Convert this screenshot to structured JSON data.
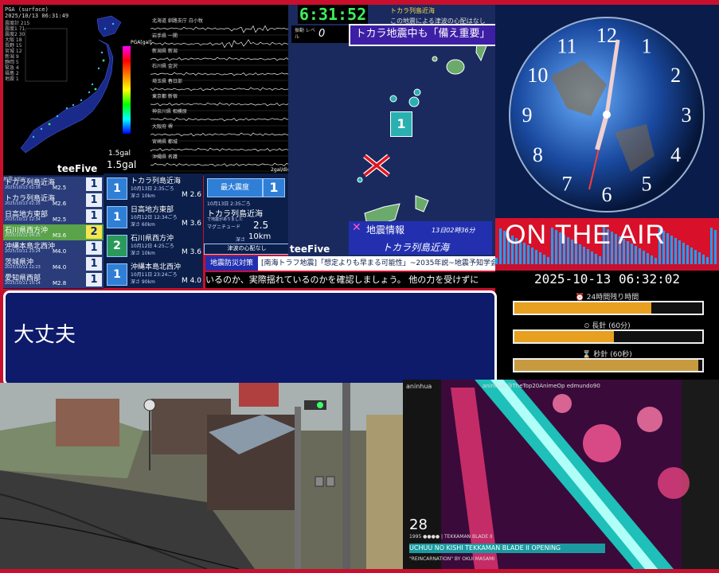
{
  "seismo": {
    "header_line1": "PGA (surface)",
    "header_line2": "2025/10/13 06:31:49",
    "scale_label": "PGA[gal]",
    "gal_value": "1.5gal",
    "small_gal": "1.5gal",
    "unit_label": "2gal/div",
    "stations": [
      "北海道 釧路支庁 白小牧",
      "岩手県 一関",
      "新潟県 新潟",
      "石川県 金沢",
      "埼玉県 春日部",
      "東京都 新宿",
      "神奈川県 相模原",
      "大阪府 堺",
      "宮崎県 都城",
      "沖縄県 名護"
    ],
    "stats": [
      "震度計 215",
      "震度1 71",
      "震度2 30",
      "大阪 18",
      "長野 15",
      "宮城 12",
      "新潟 9",
      "静岡 5",
      "緊急 4",
      "福島 2",
      "地震 1"
    ]
  },
  "logo1": "teeFive",
  "list": {
    "header": "地震 NEW",
    "rows": [
      {
        "name": "トカラ列島近海",
        "date": "2025/10/13 02:36",
        "mag": "M2.5",
        "int": "1",
        "hl": false
      },
      {
        "name": "トカラ列島近海",
        "date": "2025/10/13 02:35",
        "mag": "M2.6",
        "int": "1",
        "hl": false
      },
      {
        "name": "日高地方東部",
        "date": "2025/10/12 12:34",
        "mag": "M2.5",
        "int": "1",
        "hl": false
      },
      {
        "name": "石川県西方沖",
        "date": "2025/10/12 04:25",
        "mag": "M3.6",
        "int": "2",
        "hl": true
      },
      {
        "name": "沖縄本島北西沖",
        "date": "2025/10/11 23:24",
        "mag": "M4.0",
        "int": "1",
        "hl": false
      },
      {
        "name": "茨城県沖",
        "date": "2025/10/11 12:23",
        "mag": "M4.0",
        "int": "1",
        "hl": false
      },
      {
        "name": "愛知県西部",
        "date": "2025/10/11 10:14",
        "mag": "M2.8",
        "int": "1",
        "hl": false
      }
    ]
  },
  "detail": [
    {
      "int": "1",
      "name": "トカラ列島近海",
      "date": "10月13日 2:35ごろ",
      "depth": "深さ 10km",
      "mag": "M 2.6",
      "green": false
    },
    {
      "int": "1",
      "name": "日高地方東部",
      "date": "10月12日 12:34ごろ",
      "depth": "深さ 60km",
      "mag": "M 3.6",
      "green": false
    },
    {
      "int": "2",
      "name": "石川県西方沖",
      "date": "10月12日 4:25ごろ",
      "depth": "深さ 10km",
      "mag": "M 3.6",
      "green": true
    },
    {
      "int": "1",
      "name": "沖縄本島北西沖",
      "date": "10月11日 23:24ごろ",
      "depth": "深さ 90km",
      "mag": "M 4.0",
      "green": false
    }
  ],
  "maxint": {
    "label": "最大震度",
    "value": "1",
    "date": "10月13日 2:35ごろ",
    "location": "トカラ列島近海",
    "sub": "で地震がありました",
    "mag_label": "マグニチュード",
    "mag": "2.5",
    "depth_label": "深さ",
    "depth": "10km",
    "tsunami": "津波の心配なし"
  },
  "map": {
    "digital_clock": "6:31:52",
    "news_top": "この地震による津波の心配はなし",
    "news_top2": "トカラ列島近海",
    "alert_label": "振動 レベル",
    "alert_value": "0",
    "headline": "トカラ地震中も「備え重要」",
    "epicenter_int": "1",
    "info_title": "地震情報",
    "info_time": "13日02時36分",
    "info_loc": "トカラ列島近海",
    "logo": "teeFive"
  },
  "ticker": {
    "tag": "地震防災対策",
    "text": "[南海トラフ地震]「想定よりも早まる可能性」~2035年説~地震予知学会",
    "line2": "いるのか、実際揺れているのかを確認しましょう。 他の力を受けずに"
  },
  "clock": {
    "numbers": [
      "12",
      "1",
      "2",
      "3",
      "4",
      "5",
      "6",
      "7",
      "8",
      "9",
      "10",
      "11"
    ],
    "onair": "ON THE AIR",
    "datetime": "2025-10-13 06:32:02",
    "bars": [
      {
        "label": "⏰ 24時間残り時間",
        "fraction": 0.73
      },
      {
        "label": "⏲ 長針 (60分)",
        "fraction": 0.53
      },
      {
        "label": "⌛ 秒針 (60秒)",
        "fraction": 0.98
      }
    ]
  },
  "dialog": {
    "text": "大丈夫"
  },
  "anime": {
    "channel": "aninhua",
    "links": "aninhua  @TheTop20AnimeOp  edmundo90",
    "number": "28",
    "year": "1995 ●●●● | TEKKAMAN BLADE II",
    "title": "UCHUU NO KISHI TEKKAMAN BLADE II OPENING",
    "subtitle": "\"REINCARNATION\" BY OKUI MASAMI"
  },
  "colors": {
    "border": "#c8102e",
    "panel": "#0b1f4a",
    "accent": "#2f7fd6",
    "clock_green": "#3ef05a"
  }
}
